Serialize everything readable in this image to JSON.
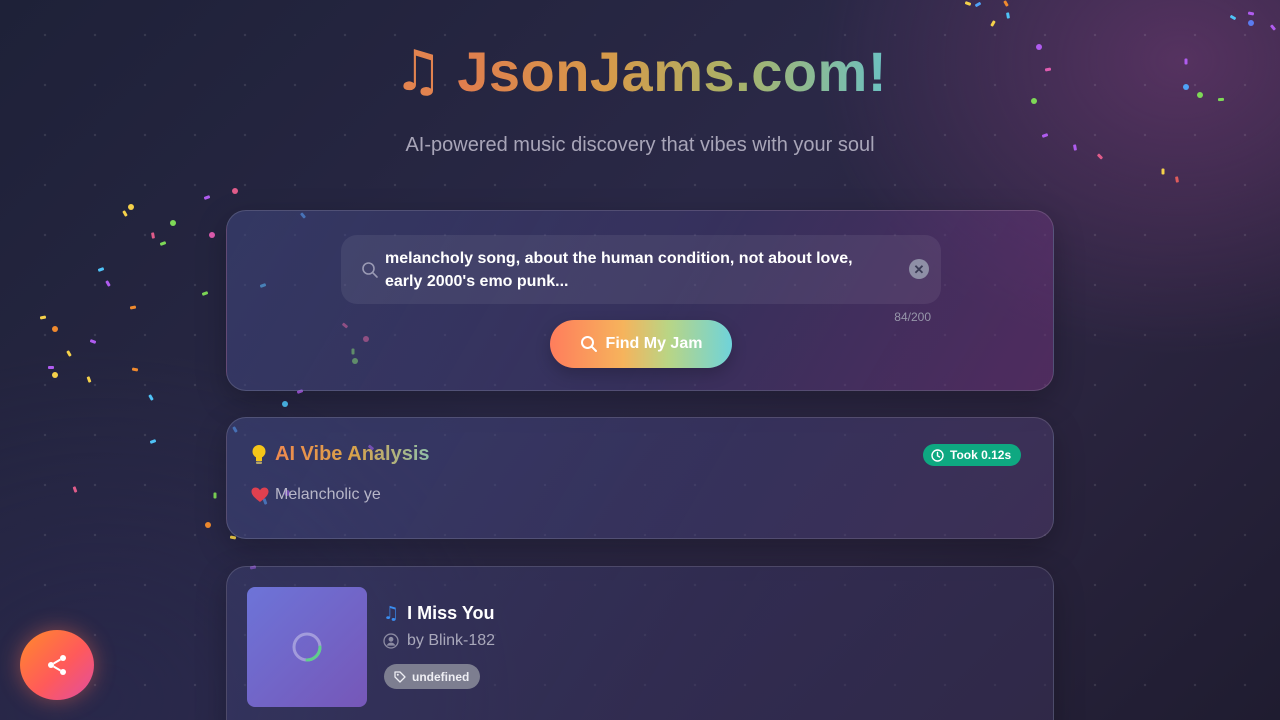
{
  "brand": {
    "icon": "music-note-icon",
    "title": "JsonJams.com!",
    "subtitle": "AI-powered music discovery that vibes with your soul"
  },
  "search": {
    "query": "melancholy song, about the human condition, not about love, early 2000's emo punk...",
    "char_count": "84/200",
    "button_label": "Find My Jam",
    "clear_symbol": "✕"
  },
  "analysis": {
    "title": "AI Vibe Analysis",
    "took_label": "Took 0.12s",
    "vibe_text": "Melancholic ye"
  },
  "result": {
    "song_title": "I Miss You",
    "artist": "by Blink-182",
    "genre_tag": "undefined"
  },
  "colors": {
    "accent_orange": "#f08a4e",
    "accent_teal": "#6fd3da",
    "badge_green": "#0ea881"
  }
}
